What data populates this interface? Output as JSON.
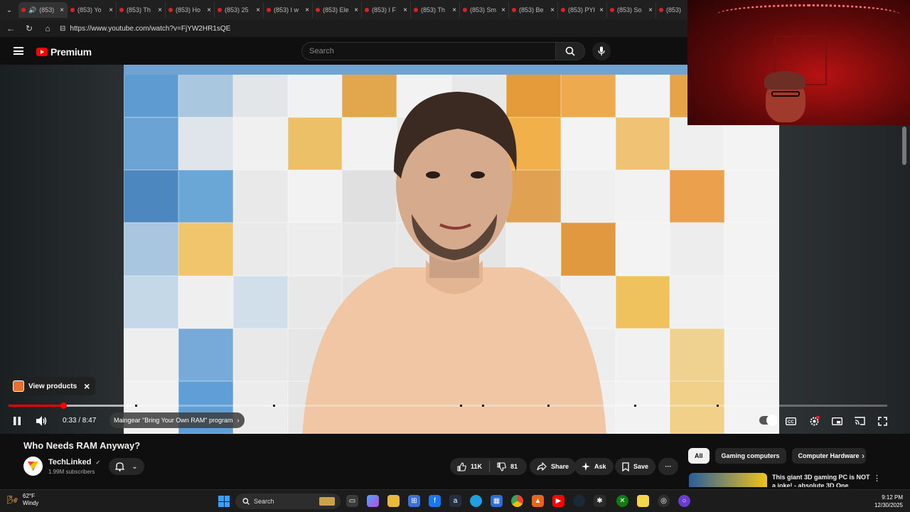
{
  "browser": {
    "tabs": [
      {
        "label": "(853)"
      },
      {
        "label": "(853) Yo"
      },
      {
        "label": "(853) Th"
      },
      {
        "label": "(853) Ho"
      },
      {
        "label": "(853) 25"
      },
      {
        "label": "(853) I w"
      },
      {
        "label": "(853) Ele"
      },
      {
        "label": "(853) I F"
      },
      {
        "label": "(853) Th"
      },
      {
        "label": "(853) Sm"
      },
      {
        "label": "(853) Be"
      },
      {
        "label": "(853) PYI"
      },
      {
        "label": "(853) So"
      },
      {
        "label": "(853)"
      }
    ],
    "url": "https://www.youtube.com/watch?v=FjYW2HR1sQE"
  },
  "youtube": {
    "logo_text": "Premium",
    "search_placeholder": "Search"
  },
  "player": {
    "view_products_label": "View products",
    "time_display": "0:33 / 8:47",
    "progress_fraction": 0.063,
    "buffered_fraction": 0.14,
    "chapter_label": "Maingear \"Bring Your Own RAM\" program",
    "chapter_arrow": "›"
  },
  "video": {
    "title": "Who Needs RAM Anyway?",
    "channel_name": "TechLinked",
    "verified_glyph": "✓",
    "subscribers": "1.99M subscribers",
    "likes": "11K",
    "dislikes": "81",
    "share_label": "Share",
    "ask_label": "Ask",
    "save_label": "Save",
    "more_glyph": "···"
  },
  "sidebar": {
    "chips": [
      "All",
      "Gaming computers",
      "Computer Hardware"
    ],
    "next_glyph": "›",
    "recommendation_title": "This giant 3D gaming PC is NOT a joke! - absolute 3D One"
  },
  "taskbar": {
    "temperature": "62°F",
    "condition": "Windy",
    "search_label": "Search",
    "time": "9:12 PM",
    "date": "12/30/2025"
  },
  "colors": {
    "accent": "#ff0000",
    "background": "#0f0f0f",
    "chip_bg": "#272727"
  }
}
